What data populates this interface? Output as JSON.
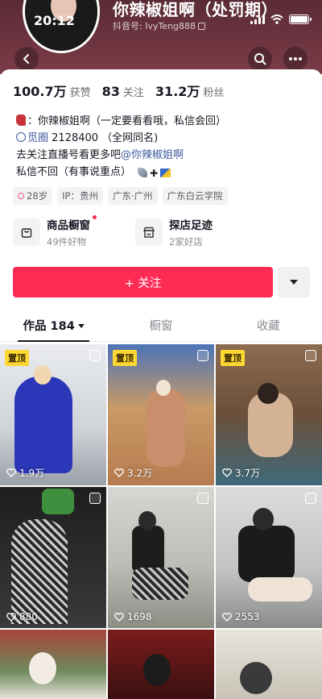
{
  "status_bar": {
    "time": "20:12"
  },
  "profile": {
    "display_name": "你辣椒姐啊（处罚期）",
    "douyin_id": "抖音号: IvyTeng888"
  },
  "stats": [
    {
      "value": "100.7万",
      "label": "获赞"
    },
    {
      "value": "83",
      "label": "关注"
    },
    {
      "value": "31.2万",
      "label": "粉丝"
    }
  ],
  "bio": {
    "line1": "：你辣椒姐啊（一定要看看哦，私信会回）",
    "line2_mention": "觅圈",
    "line2_rest": " 2128400 （全网同名)",
    "line3_prefix": "去关注直播号看更多吧",
    "line3_mention": "@你辣椒姐啊",
    "line4": "私信不回（有事说重点）"
  },
  "tags": [
    {
      "label": "28岁",
      "icon": "female-icon"
    },
    {
      "label": "IP：贵州"
    },
    {
      "label": "广东·广州"
    },
    {
      "label": "广东白云学院"
    }
  ],
  "features": {
    "shop": {
      "title": "商品橱窗",
      "subtitle": "49件好物"
    },
    "visits": {
      "title": "探店足迹",
      "subtitle": "2家好店"
    }
  },
  "follow_button": {
    "label": "+ 关注"
  },
  "tabs": [
    {
      "label": "作品 184",
      "active": true
    },
    {
      "label": "橱窗",
      "active": false
    },
    {
      "label": "收藏",
      "active": false
    }
  ],
  "pinned_label": "置顶",
  "posts": [
    {
      "likes": "1.9万",
      "pinned": true
    },
    {
      "likes": "3.2万",
      "pinned": true
    },
    {
      "likes": "3.7万",
      "pinned": true
    },
    {
      "likes": "880",
      "pinned": false
    },
    {
      "likes": "1698",
      "pinned": false
    },
    {
      "likes": "2553",
      "pinned": false
    }
  ],
  "colors": {
    "accent": "#fe2c55",
    "cover": "#6d3440",
    "pin": "#fdd733",
    "mention": "#3c5a9e"
  }
}
